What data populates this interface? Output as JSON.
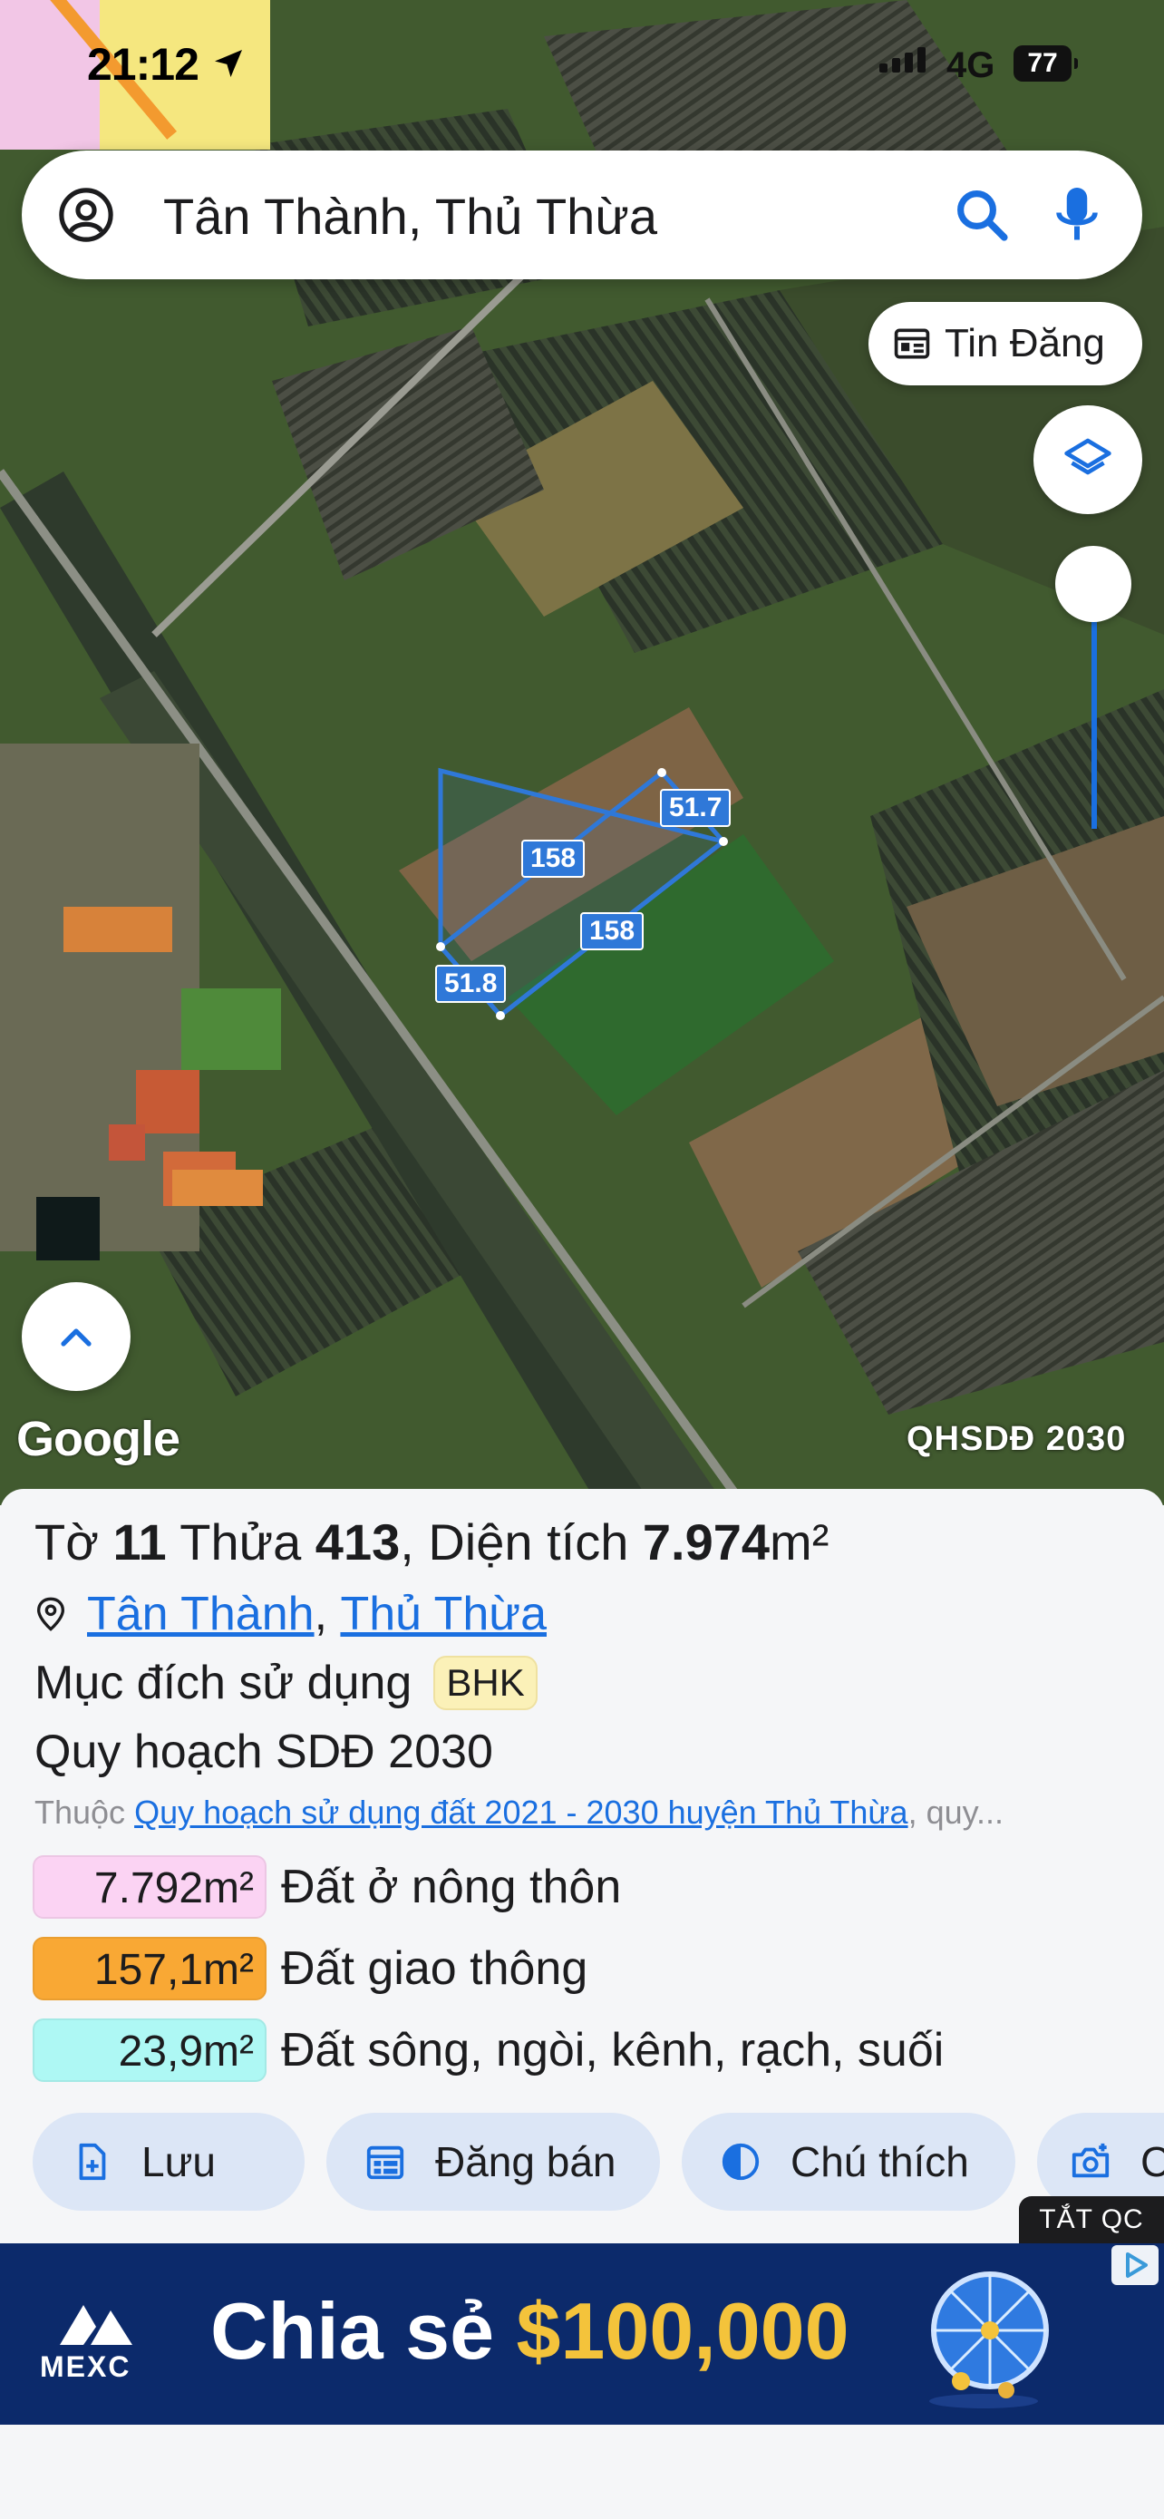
{
  "status": {
    "time": "21:12",
    "network": "4G",
    "battery": "77"
  },
  "search": {
    "query": "Tân Thành, Thủ Thừa"
  },
  "map": {
    "tin_dang_label": "Tin Đăng",
    "google_label": "Google",
    "plan_badge": "QHSDĐ 2030",
    "measures": {
      "top_long": "158",
      "top_short": "51.7",
      "bottom_long": "158",
      "left_short": "51.8"
    }
  },
  "parcel": {
    "sheet_label": "Tờ",
    "sheet_no": "11",
    "lot_label": "Thửa",
    "lot_no": "413",
    "area_label": ", Diện tích",
    "area_value": "7.974",
    "area_unit": "m²",
    "commune": "Tân Thành",
    "district": "Thủ Thừa",
    "purpose_label": "Mục đích sử dụng",
    "purpose_code": "BHK",
    "plan_title": "Quy hoạch SDĐ 2030",
    "belongs_prefix": "Thuộc",
    "belongs_link": "Quy hoạch sử dụng đất 2021 - 2030 huyện Thủ Thừa",
    "belongs_suffix": ", quy..."
  },
  "areas": [
    {
      "value": "7.792m²",
      "label": "Đất ở nông thôn",
      "color": "#fbd3f3"
    },
    {
      "value": "157,1m²",
      "label": "Đất giao thông",
      "color": "#f9a834"
    },
    {
      "value": "23,9m²",
      "label": "Đất sông, ngòi, kênh, rạch, suối",
      "color": "#aef8f4"
    }
  ],
  "actions": [
    {
      "label": "Lưu",
      "icon": "file-plus-icon"
    },
    {
      "label": "Đăng bán",
      "icon": "calendar-icon"
    },
    {
      "label": "Chú thích",
      "icon": "half-circle-icon"
    },
    {
      "label": "C",
      "icon": "camera-plus-icon"
    }
  ],
  "ad": {
    "close_label": "TẮT QC",
    "brand": "MEXC",
    "text": "Chia sẻ",
    "amount": "$100,000"
  },
  "colors": {
    "accent": "#1a6fe0",
    "action_bg": "#dce6f6",
    "ad_bg": "#0c2a6b",
    "ad_amount": "#f4c33b"
  }
}
